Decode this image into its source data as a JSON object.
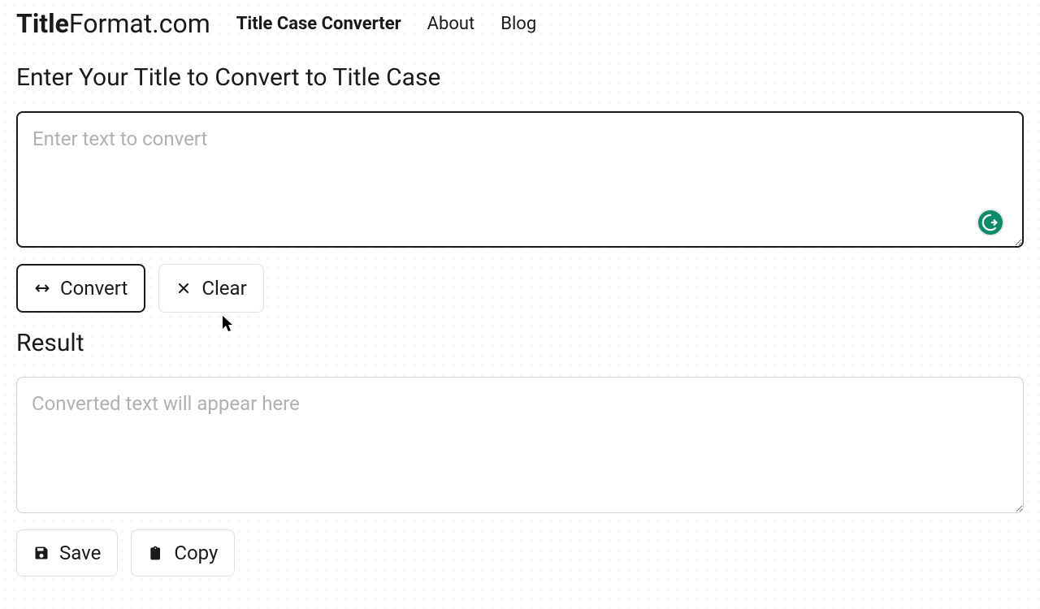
{
  "header": {
    "logo_bold": "Title",
    "logo_rest": "Format.com"
  },
  "nav": {
    "converter": "Title Case Converter",
    "about": "About",
    "blog": "Blog"
  },
  "input": {
    "heading": "Enter Your Title to Convert to Title Case",
    "placeholder": "Enter text to convert",
    "value": ""
  },
  "buttons": {
    "convert": "Convert",
    "clear": "Clear",
    "save": "Save",
    "copy": "Copy"
  },
  "result": {
    "heading": "Result",
    "placeholder": "Converted text will appear here",
    "value": ""
  }
}
